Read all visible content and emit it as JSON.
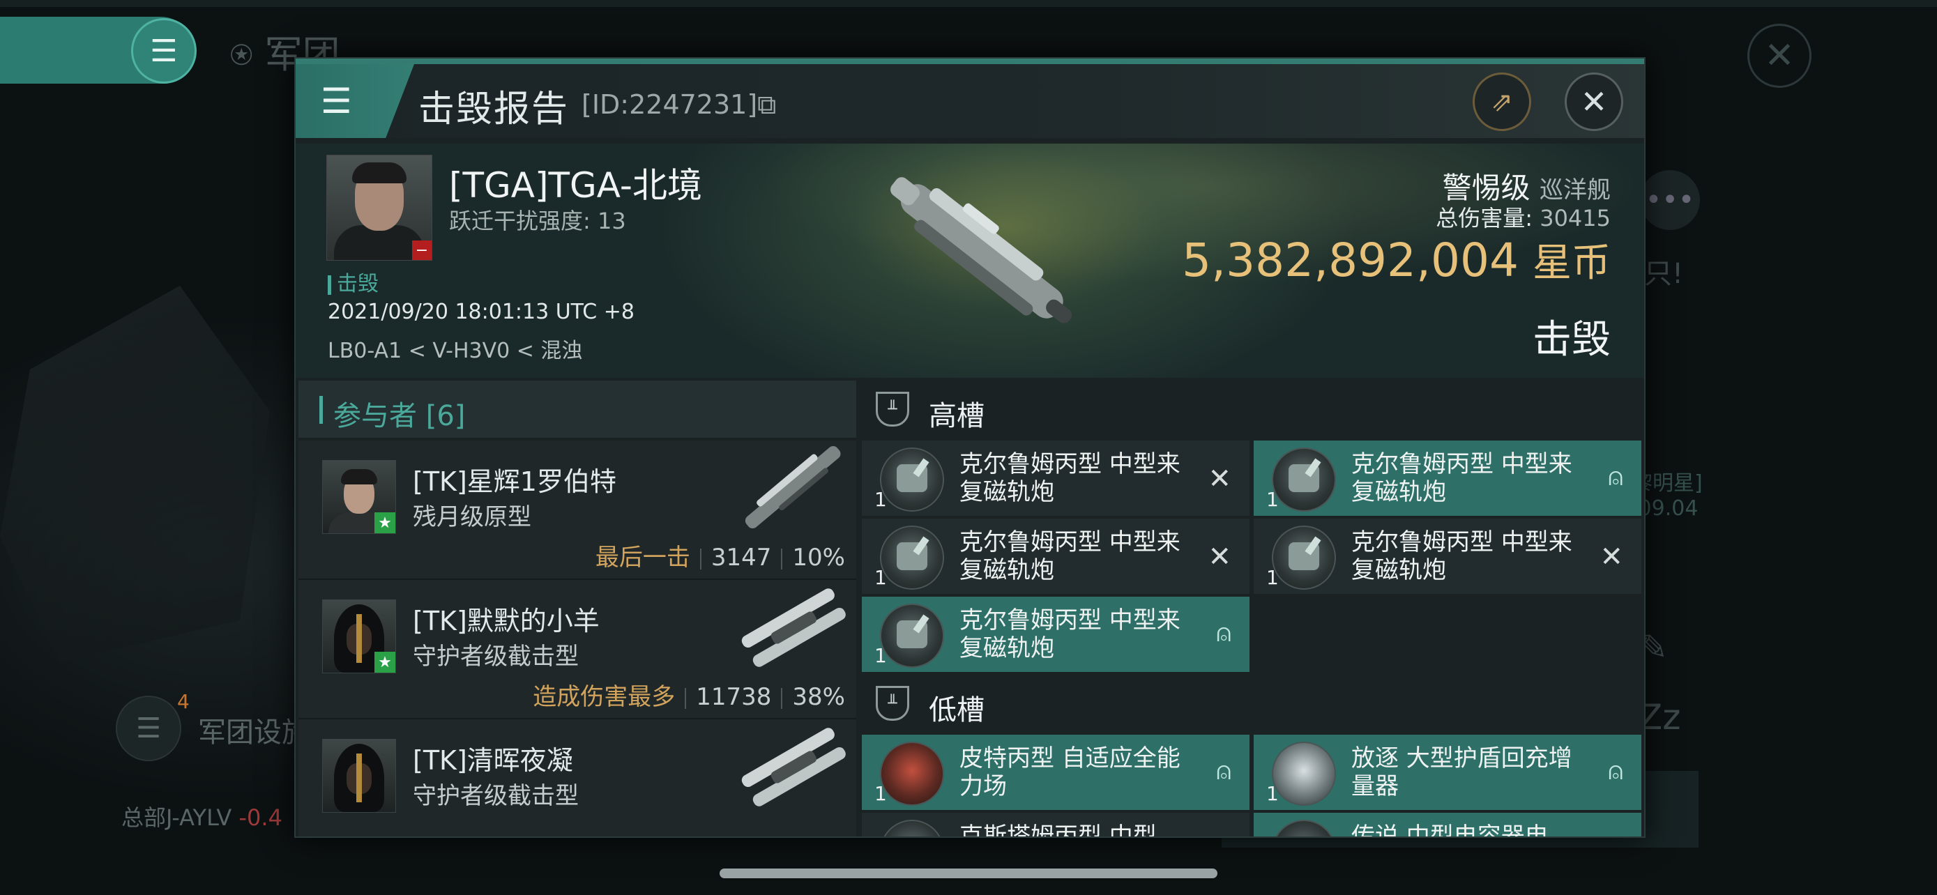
{
  "background": {
    "title": "军团",
    "right_text_1": "只!",
    "right_text_2": "黎明星]",
    "right_text_3": ".09.04",
    "legion_badge": "4",
    "legion_text": "军团设施",
    "hq_label": "总部J-AYLV",
    "hq_value": "-0.4"
  },
  "dialog": {
    "title": "击毁报告",
    "report_id": "[ID:2247231]",
    "copy_glyph": "⧉",
    "menu_icon": "menu-icon",
    "share_icon": "share-icon",
    "close_glyph": "✕"
  },
  "victim": {
    "name": "[TGA]TGA-北境",
    "warp_label": "跃迁干扰强度: 13",
    "status": "击毁",
    "timestamp": "2021/09/20 18:01:13 UTC +8",
    "location": "LB0-A1 < V-H3V0 < 混浊",
    "ship_name": "警惕级",
    "ship_class": "巡洋舰",
    "damage_label": "总伤害量:",
    "damage_value": "30415",
    "isk_value": "5,382,892,004",
    "isk_unit": "星币",
    "result": "击毁"
  },
  "participants": {
    "header": "参与者 [6]",
    "rows": [
      {
        "name": "[TK]星辉1罗伯特",
        "ship": "残月级原型",
        "tag": "最后一击",
        "damage": "3147",
        "percent": "10%"
      },
      {
        "name": "[TK]默默的小羊",
        "ship": "守护者级截击型",
        "tag": "造成伤害最多",
        "damage": "11738",
        "percent": "38%"
      },
      {
        "name": "[TK]清晖夜凝",
        "ship": "守护者级截击型",
        "tag": "",
        "damage": "",
        "percent": ""
      }
    ]
  },
  "slots": {
    "high_label": "高槽",
    "low_label": "低槽",
    "high": [
      {
        "qty": "1",
        "name": "克尔鲁姆丙型 中型来复磁轨炮",
        "state": "destroyed",
        "glyph": "✕"
      },
      {
        "qty": "1",
        "name": "克尔鲁姆丙型 中型来复磁轨炮",
        "state": "dropped",
        "glyph": "👤"
      },
      {
        "qty": "1",
        "name": "克尔鲁姆丙型 中型来复磁轨炮",
        "state": "destroyed",
        "glyph": "✕"
      },
      {
        "qty": "1",
        "name": "克尔鲁姆丙型 中型来复磁轨炮",
        "state": "destroyed",
        "glyph": "✕"
      },
      {
        "qty": "1",
        "name": "克尔鲁姆丙型 中型来复磁轨炮",
        "state": "dropped",
        "glyph": "👤"
      }
    ],
    "low": [
      {
        "qty": "1",
        "name": "皮特丙型 自适应全能力场",
        "state": "dropped",
        "glyph": "👤"
      },
      {
        "qty": "1",
        "name": "放逐 大型护盾回充增量器",
        "state": "dropped",
        "glyph": "👤"
      },
      {
        "qty": "",
        "name": "克斯塔姆丙型 中型",
        "state": "partial",
        "glyph": ""
      },
      {
        "qty": "",
        "name": "传说 中型电容器电",
        "state": "partial",
        "glyph": ""
      }
    ]
  },
  "colors": {
    "accent": "#4aa99a",
    "teal_slot": "#2e6f68",
    "gold": "#e7c17a",
    "tag_gold": "#d1a35c"
  }
}
